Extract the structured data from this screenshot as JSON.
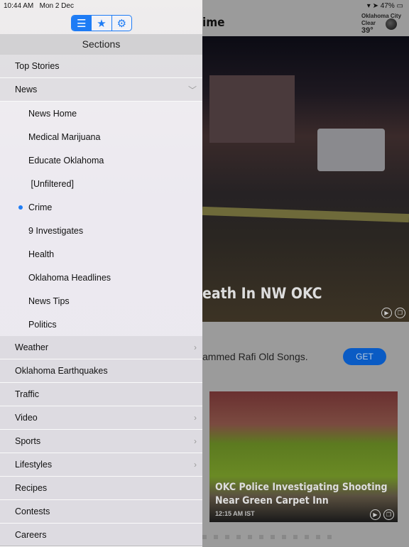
{
  "status_bar": {
    "time": "10:44 AM",
    "date": "Mon 2 Dec",
    "battery": "47%"
  },
  "segmented": {
    "items": [
      {
        "icon": "list-icon",
        "glyph": "☰"
      },
      {
        "icon": "star-icon",
        "glyph": "★"
      },
      {
        "icon": "gear-icon",
        "glyph": "⚙"
      }
    ],
    "selected": 0
  },
  "sections": {
    "title": "Sections",
    "items": [
      {
        "label": "Top Stories"
      },
      {
        "label": "News",
        "chevron": "﹀"
      },
      {
        "label": "News Home",
        "sub": true
      },
      {
        "label": "Medical Marijuana",
        "sub": true
      },
      {
        "label": "Educate Oklahoma",
        "sub": true
      },
      {
        "label": " [Unfiltered]",
        "sub": true
      },
      {
        "label": "Crime",
        "sub": true,
        "selected": true
      },
      {
        "label": "9 Investigates",
        "sub": true
      },
      {
        "label": "Health",
        "sub": true
      },
      {
        "label": "Oklahoma Headlines",
        "sub": true
      },
      {
        "label": "News Tips",
        "sub": true
      },
      {
        "label": "Politics",
        "sub": true
      },
      {
        "label": "Weather",
        "chevron": "›"
      },
      {
        "label": "Oklahoma Earthquakes"
      },
      {
        "label": "Traffic"
      },
      {
        "label": "Video",
        "chevron": "›"
      },
      {
        "label": "Sports",
        "chevron": "›"
      },
      {
        "label": "Lifestyles",
        "chevron": "›"
      },
      {
        "label": "Recipes"
      },
      {
        "label": "Contests"
      },
      {
        "label": "Careers"
      }
    ]
  },
  "main": {
    "title": "ime",
    "weather": {
      "city": "Oklahoma City",
      "condition": "Clear",
      "temp": "39°"
    },
    "hero_title": "eath In NW OKC",
    "ad": {
      "text": "ammed Rafi Old Songs.",
      "button": "GET"
    },
    "card": {
      "title_1": "OKC Police Investigating Shooting",
      "title_2": "Near Green Carpet Inn",
      "time": "12:15 AM IST"
    }
  },
  "colors": {
    "accent": "#1e7cf5",
    "get_button": "#0a5bc4"
  }
}
